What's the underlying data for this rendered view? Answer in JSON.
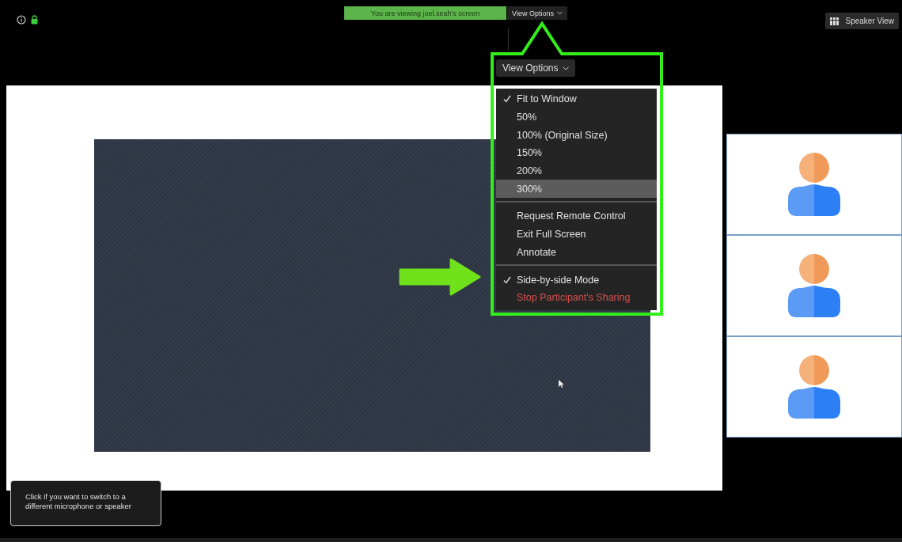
{
  "top_bar": {
    "banner": "You are viewing joel.seah's screen",
    "view_options_button": "View Options",
    "speaker_view_button": "Speaker View"
  },
  "menu": {
    "title": "View Options",
    "groups": [
      [
        {
          "label": "Fit to Window",
          "checked": true,
          "selected": false,
          "kind": "normal"
        },
        {
          "label": "50%",
          "checked": false,
          "selected": false,
          "kind": "normal"
        },
        {
          "label": "100% (Original Size)",
          "checked": false,
          "selected": false,
          "kind": "normal"
        },
        {
          "label": "150%",
          "checked": false,
          "selected": false,
          "kind": "normal"
        },
        {
          "label": "200%",
          "checked": false,
          "selected": false,
          "kind": "normal"
        },
        {
          "label": "300%",
          "checked": false,
          "selected": true,
          "kind": "normal"
        }
      ],
      [
        {
          "label": "Request Remote Control",
          "checked": false,
          "selected": false,
          "kind": "normal"
        },
        {
          "label": "Exit Full Screen",
          "checked": false,
          "selected": false,
          "kind": "normal"
        },
        {
          "label": "Annotate",
          "checked": false,
          "selected": false,
          "kind": "normal"
        }
      ],
      [
        {
          "label": "Side-by-side Mode",
          "checked": true,
          "selected": false,
          "kind": "normal"
        },
        {
          "label": "Stop Participant's Sharing",
          "checked": false,
          "selected": false,
          "kind": "danger"
        }
      ]
    ]
  },
  "participants": [
    {
      "kind": "avatar"
    },
    {
      "kind": "avatar"
    },
    {
      "kind": "avatar"
    }
  ],
  "tooltip": "Click if you want to switch to a different microphone or speaker"
}
